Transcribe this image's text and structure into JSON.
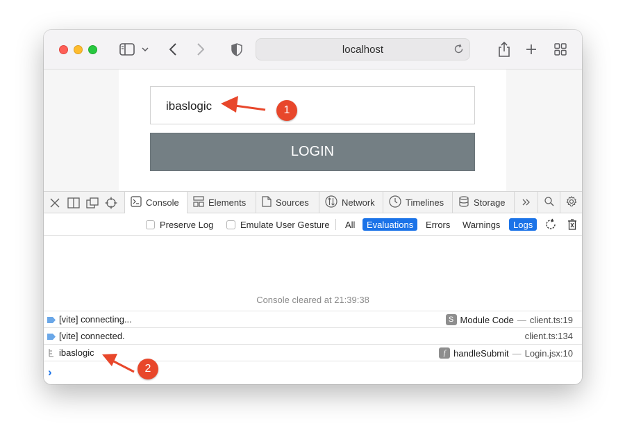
{
  "browser": {
    "address": "localhost"
  },
  "page": {
    "username_value": "ibaslogic",
    "login_label": "LOGIN"
  },
  "devtools": {
    "tabs": [
      {
        "label": "Console",
        "icon": "console-icon"
      },
      {
        "label": "Elements",
        "icon": "elements-icon"
      },
      {
        "label": "Sources",
        "icon": "sources-icon"
      },
      {
        "label": "Network",
        "icon": "network-icon"
      },
      {
        "label": "Timelines",
        "icon": "timelines-icon"
      },
      {
        "label": "Storage",
        "icon": "storage-icon"
      }
    ],
    "filters": {
      "preserve_log": "Preserve Log",
      "emulate_user_gesture": "Emulate User Gesture",
      "all": "All",
      "evaluations": "Evaluations",
      "errors": "Errors",
      "warnings": "Warnings",
      "logs": "Logs"
    },
    "cleared_message": "Console cleared at 21:39:38",
    "messages": [
      {
        "text": "[vite] connecting...",
        "badge": "S",
        "function": "Module Code",
        "dash": "—",
        "location": "client.ts:19"
      },
      {
        "text": "[vite] connected.",
        "location": "client.ts:134"
      },
      {
        "text": "ibaslogic",
        "badge": "f",
        "function": "handleSubmit",
        "dash": "—",
        "location": "Login.jsx:10"
      }
    ],
    "prompt": "›"
  },
  "annotations": {
    "callout_1": "1",
    "callout_2": "2"
  },
  "colors": {
    "accent": "#1b73e8",
    "callout": "#e8472b",
    "login_button": "#747f84"
  }
}
